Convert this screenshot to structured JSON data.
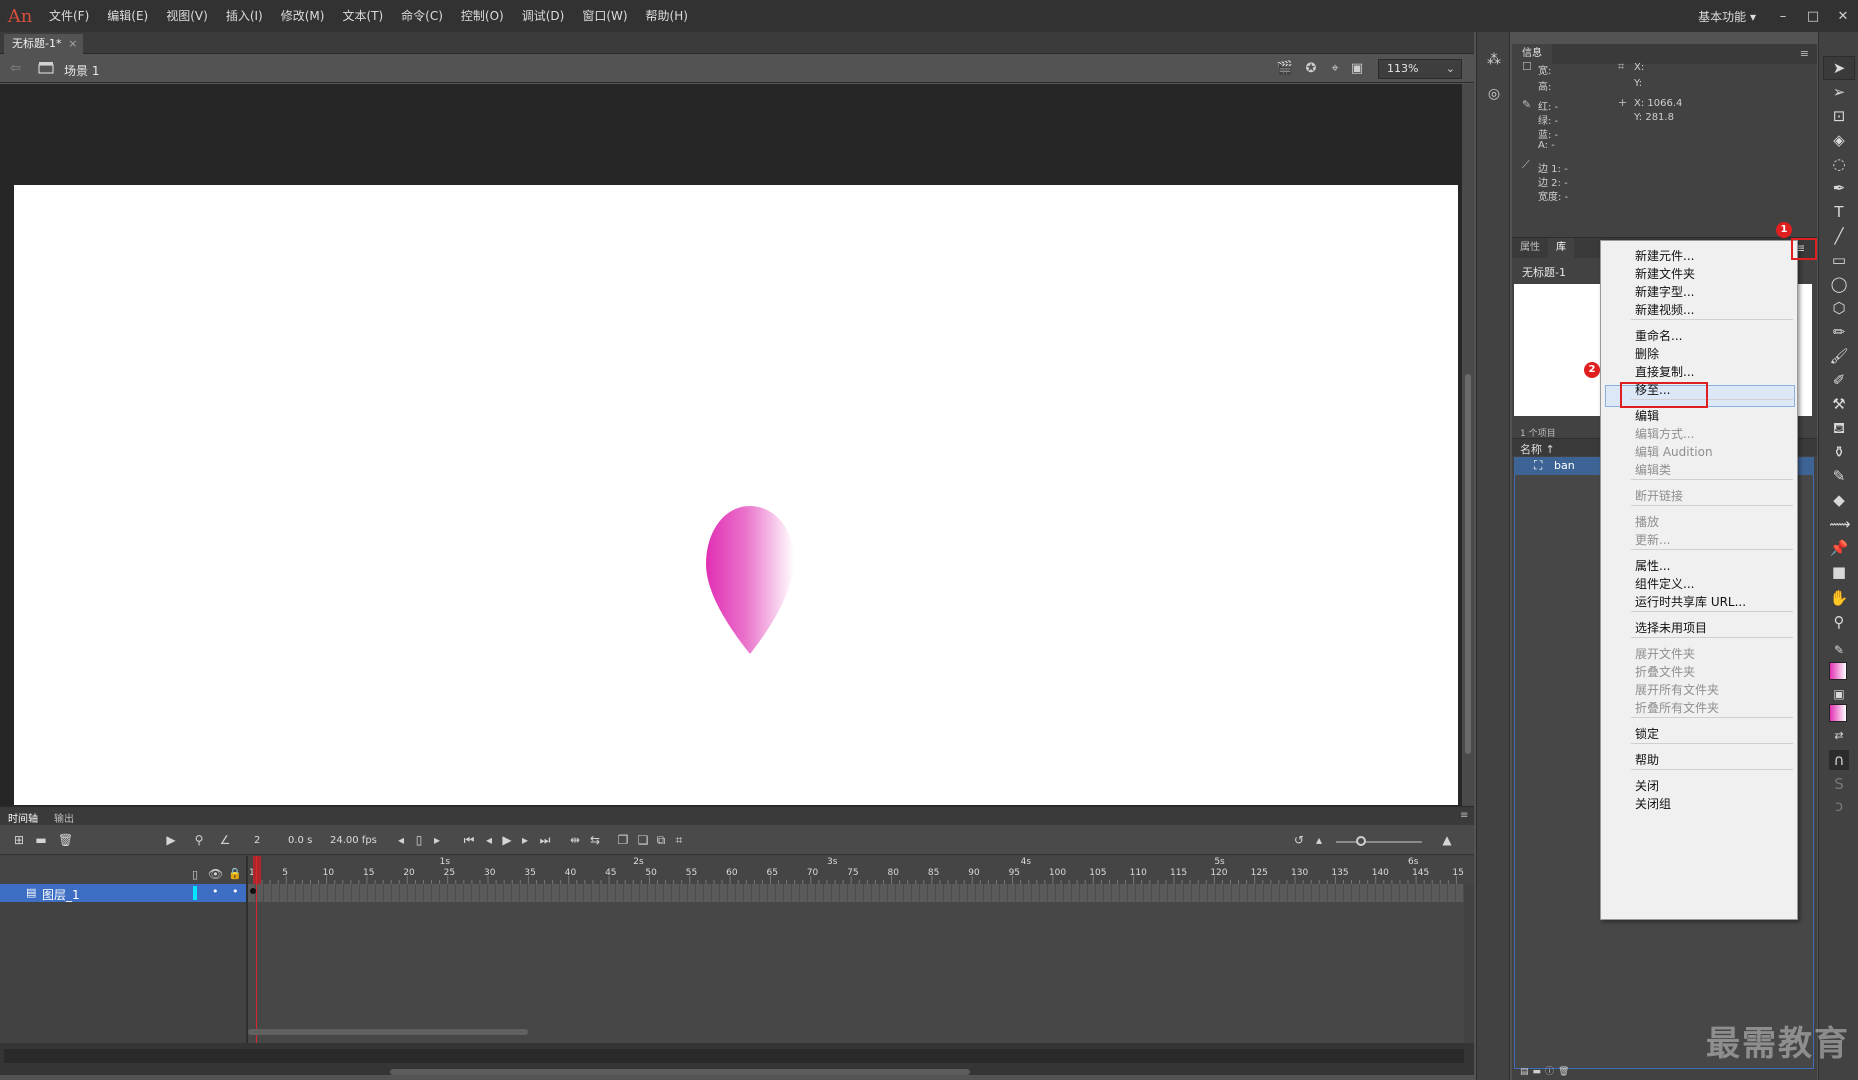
{
  "app": {
    "logo": "An",
    "menus": [
      "文件(F)",
      "编辑(E)",
      "视图(V)",
      "插入(I)",
      "修改(M)",
      "文本(T)",
      "命令(C)",
      "控制(O)",
      "调试(D)",
      "窗口(W)",
      "帮助(H)"
    ],
    "workspace": "基本功能",
    "workspace_chevron": "▾",
    "win_min": "–",
    "win_max": "□",
    "win_close": "✕"
  },
  "document": {
    "tab_title": "无标题-1*",
    "tab_close": "×",
    "scene": "场景 1",
    "zoom": "113%"
  },
  "stage": {
    "bg_color": "#ffffff",
    "pasteboard_color": "#262626",
    "petal_gradient": [
      "#e12fb4",
      "#ffffff"
    ]
  },
  "timeline": {
    "tabs": [
      "时间轴",
      "输出"
    ],
    "current_frame": "2",
    "time": "0.0 s",
    "fps": "24.00 fps",
    "frame_ticks": [
      "5",
      "10",
      "15",
      "20",
      "25",
      "30",
      "35",
      "40",
      "45",
      "50",
      "55",
      "60",
      "65",
      "70",
      "75",
      "80",
      "85",
      "90",
      "95",
      "100",
      "105",
      "110",
      "115",
      "120",
      "125",
      "130",
      "135",
      "140",
      "145",
      "15"
    ],
    "second_marks": [
      "1s",
      "2s",
      "3s",
      "4s",
      "5s",
      "6s"
    ],
    "layer_name": "图层_1",
    "frame_one": "1"
  },
  "info_panel": {
    "tab": "信息",
    "width_label": "宽:",
    "height_label": "高:",
    "red_label": "红: -",
    "green_label": "绿: -",
    "blue_label": "蓝: -",
    "alpha_label": "A: -",
    "x_label": "X:",
    "y_label": "Y:",
    "cursor_x": "X: 1066.4",
    "cursor_y": "Y: 281.8",
    "edge1": "边 1: -",
    "edge2": "边 2: -",
    "stroke_width": "宽度: -"
  },
  "library": {
    "tabs": [
      "属性",
      "库"
    ],
    "menu_icon": "≡",
    "doc_name": "无标题-1",
    "item_count": "1 个项目",
    "col_name": "名称 ↑",
    "items": [
      "ban"
    ]
  },
  "context_menu": {
    "items": [
      {
        "label": "新建元件...",
        "enabled": true
      },
      {
        "label": "新建文件夹",
        "enabled": true
      },
      {
        "label": "新建字型...",
        "enabled": true
      },
      {
        "label": "新建视频...",
        "enabled": true
      },
      {
        "label": "重命名...",
        "enabled": true
      },
      {
        "label": "删除",
        "enabled": true
      },
      {
        "label": "直接复制...",
        "enabled": true,
        "highlighted": true
      },
      {
        "label": "移至...",
        "enabled": true
      },
      {
        "label": "编辑",
        "enabled": true
      },
      {
        "label": "编辑方式...",
        "enabled": false
      },
      {
        "label": "编辑 Audition",
        "enabled": false
      },
      {
        "label": "编辑类",
        "enabled": false
      },
      {
        "label": "断开链接",
        "enabled": false
      },
      {
        "label": "播放",
        "enabled": false
      },
      {
        "label": "更新...",
        "enabled": false
      },
      {
        "label": "属性...",
        "enabled": true
      },
      {
        "label": "组件定义...",
        "enabled": true
      },
      {
        "label": "运行时共享库 URL...",
        "enabled": true
      },
      {
        "label": "选择未用项目",
        "enabled": true
      },
      {
        "label": "展开文件夹",
        "enabled": false
      },
      {
        "label": "折叠文件夹",
        "enabled": false
      },
      {
        "label": "展开所有文件夹",
        "enabled": false
      },
      {
        "label": "折叠所有文件夹",
        "enabled": false
      },
      {
        "label": "锁定",
        "enabled": true
      },
      {
        "label": "帮助",
        "enabled": true
      },
      {
        "label": "关闭",
        "enabled": true
      },
      {
        "label": "关闭组",
        "enabled": true
      }
    ]
  },
  "callouts": {
    "badge1": "1",
    "badge2": "2"
  },
  "watermark": "最需教育"
}
